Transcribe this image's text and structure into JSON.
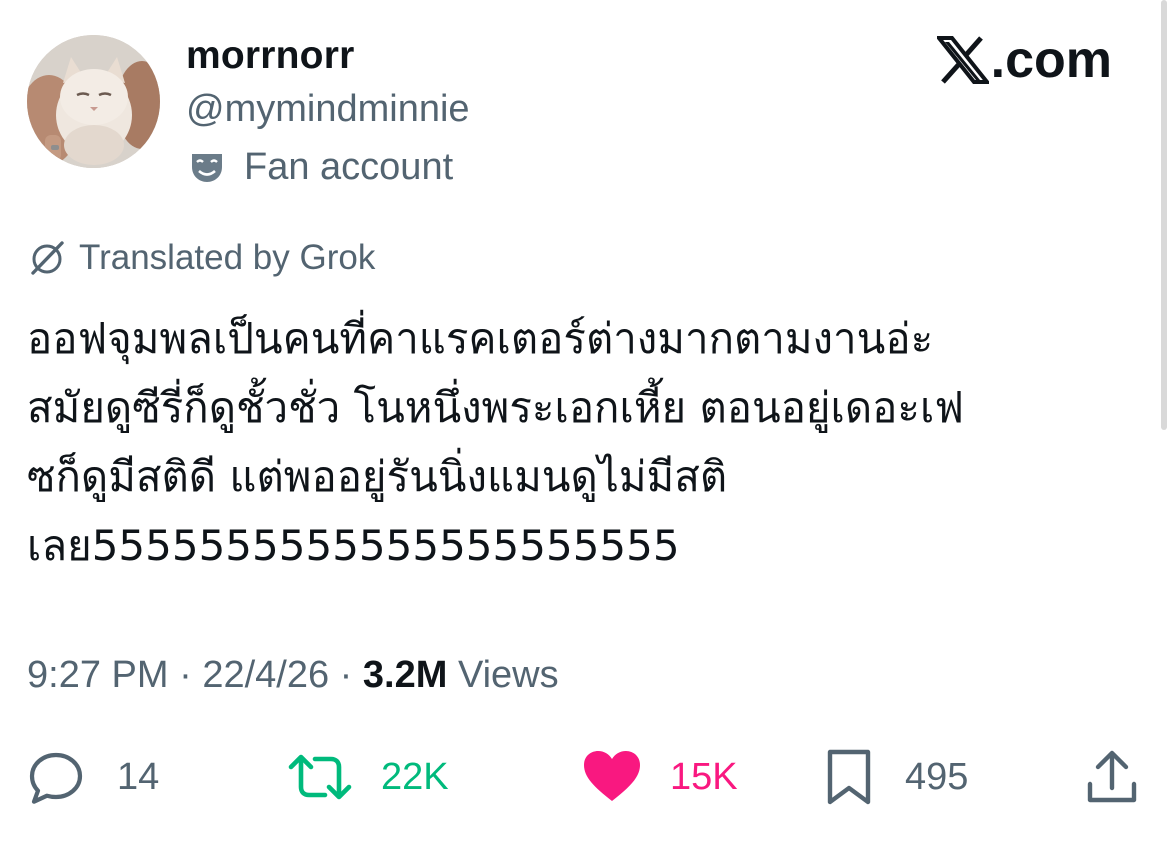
{
  "author": {
    "display_name": "morrnorr",
    "handle": "@mymindminnie",
    "badge_label": "Fan account"
  },
  "brand": {
    "label": ".com"
  },
  "translation": {
    "label": "Translated by Grok"
  },
  "tweet": {
    "lines": [
      "ออฟจุมพลเป็นคนที่คาแรคเตอร์ต่างมากตามงานอ่ะ",
      "สมัยดูซีรี่ก็ดูชั้วชั่ว โนหนึ่งพระเอกเหี้ย ตอนอยู่เดอะเฟ",
      "ซก็ดูมีสติดี แต่พออยู่รันนิ่งแมนดูไม่มีสติ",
      "เลย5555555555555555555555"
    ]
  },
  "meta": {
    "time": "9:27 PM",
    "separator": " · ",
    "date": "22/4/26",
    "views_count": "3.2M",
    "views_label": "Views"
  },
  "actions": {
    "replies": "14",
    "reposts": "22K",
    "likes": "15K",
    "bookmarks": "495"
  },
  "colors": {
    "text_primary": "#0f1419",
    "text_secondary": "#536471",
    "repost_active": "#00ba7c",
    "like_active": "#f91880"
  },
  "icons": {
    "badge": "theater-masks-icon",
    "translate": "grok-icon",
    "reply": "comment-icon",
    "repost": "repost-icon",
    "like": "heart-icon",
    "bookmark": "bookmark-icon",
    "share": "share-icon",
    "brand": "x-logo-icon"
  }
}
